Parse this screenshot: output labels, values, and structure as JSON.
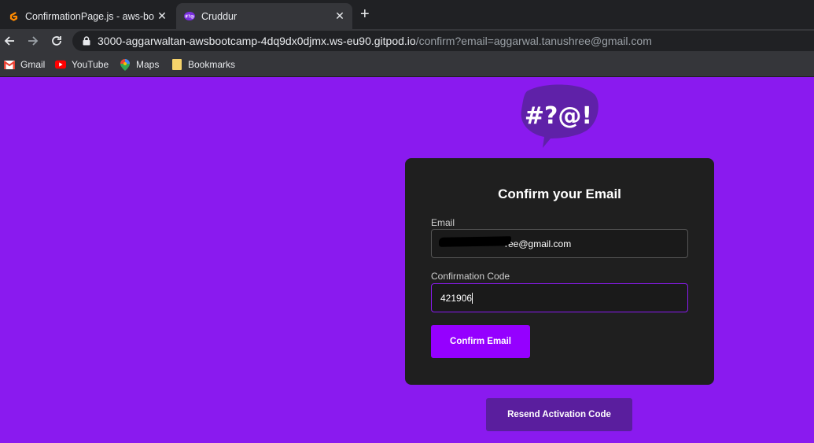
{
  "browser": {
    "tabs": [
      {
        "title": "ConfirmationPage.js - aws-bootc",
        "active": false
      },
      {
        "title": "Cruddur",
        "active": true
      }
    ],
    "new_tab_label": "+",
    "close_glyph": "✕",
    "url": {
      "host": "3000-aggarwaltan-awsbootcamp-4dq9dx0djmx.ws-eu90.gitpod.io",
      "path": "/confirm?email=aggarwal.tanushree@gmail.com"
    },
    "bookmarks": [
      {
        "label": "Gmail",
        "icon": "gmail-icon"
      },
      {
        "label": "YouTube",
        "icon": "youtube-icon"
      },
      {
        "label": "Maps",
        "icon": "maps-icon"
      },
      {
        "label": "Bookmarks",
        "icon": "folder-icon"
      }
    ]
  },
  "logo": {
    "text": "#?@!",
    "color": "#5f21a8"
  },
  "form": {
    "title": "Confirm your Email",
    "email_label": "Email",
    "email_value": "ree@gmail.com",
    "code_label": "Confirmation Code",
    "code_value": "421906",
    "submit_label": "Confirm Email"
  },
  "resend_label": "Resend Activation Code",
  "colors": {
    "page_bg": "#8a1aef",
    "card_bg": "#1f1f1f",
    "primary_button": "#9500ff",
    "resend_button": "#5a1e9e"
  }
}
